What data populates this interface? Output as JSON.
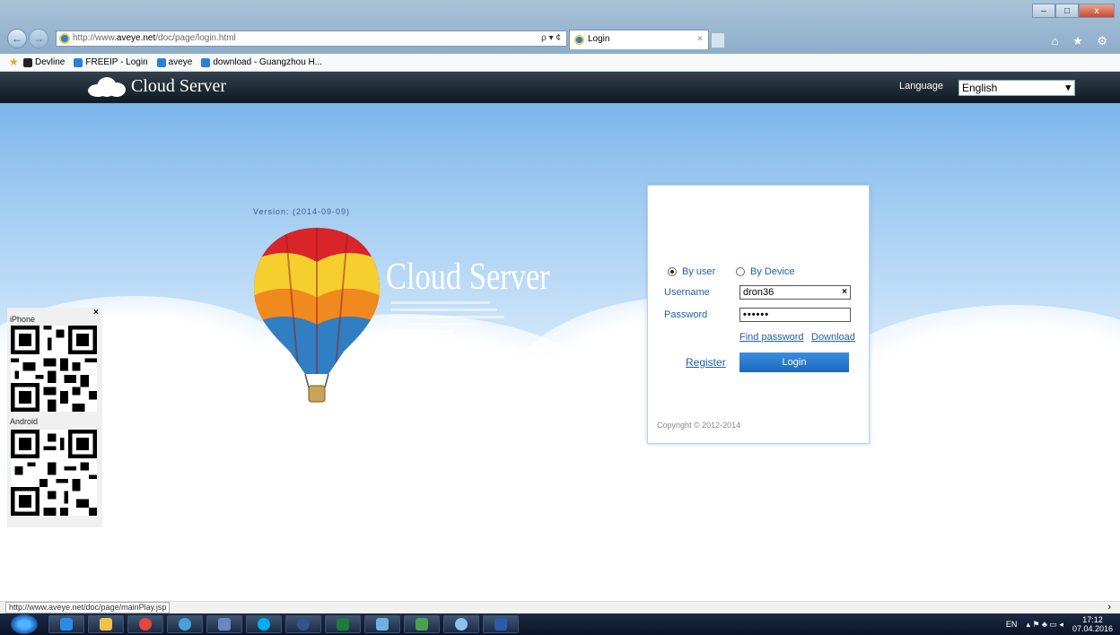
{
  "browser": {
    "address_prefix": "http://www.",
    "address_host": "aveye.net",
    "address_path": "/doc/page/login.html",
    "address_tools": "ρ ▾ ¢",
    "tab_title": "Login",
    "tab_close": "×",
    "window_buttons": [
      "–",
      "□",
      "x"
    ],
    "chrome_icons": "⌂ ★ ⚙",
    "favorites": [
      "Devline",
      "FREEIP - Login",
      "aveye",
      "download - Guangzhou H..."
    ],
    "status_url": "http://www.aveye.net/doc/page/mainPlay.jsp",
    "nav_back": "←",
    "nav_forward": "→"
  },
  "header": {
    "title": "Cloud Server",
    "language_label": "Language",
    "language_value": "English",
    "chevron": "▾"
  },
  "hero": {
    "title": "Cloud Server",
    "version": "Version: (2014-09-09)"
  },
  "login": {
    "by_user": "By user",
    "by_device": "By Device",
    "username_label": "Username",
    "username_value": "dron36",
    "clear": "×",
    "password_label": "Password",
    "password_value": "••••••",
    "find_password": "Find password",
    "download": "Download",
    "register": "Register",
    "login_button": "Login",
    "copyright": "Copyright © 2012-2014"
  },
  "qr": {
    "close": "×",
    "iphone_label": "iPhone",
    "android_label": "Android"
  },
  "tray": {
    "lang": "EN",
    "time": "17:12",
    "date": "07.04.2016"
  }
}
